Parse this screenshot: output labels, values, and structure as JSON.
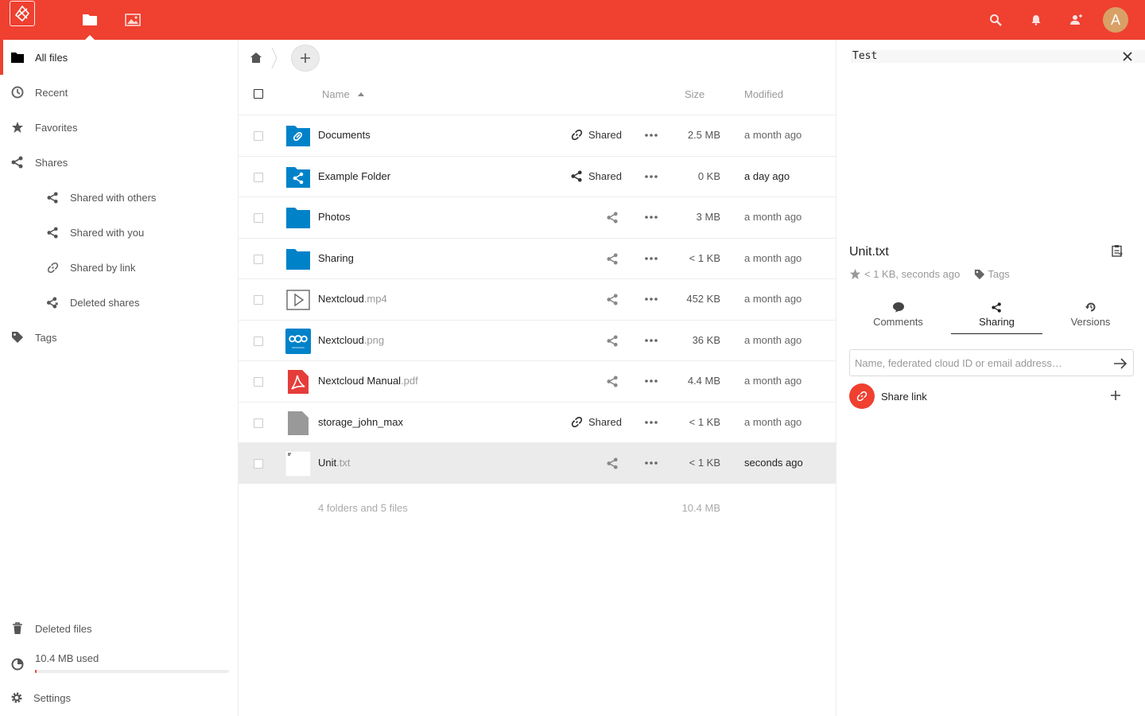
{
  "header": {
    "logo": "nextcloud-logo-icon",
    "apps": [
      {
        "name": "files-icon",
        "active": true
      },
      {
        "name": "gallery-icon",
        "active": false
      }
    ],
    "right_icons": [
      "search-icon",
      "bell-icon",
      "contacts-icon"
    ],
    "avatar_letter": "A",
    "colors": {
      "brand": "#ef4030",
      "avatar": "#d9a066"
    }
  },
  "sidebar": {
    "items": [
      {
        "label": "All files",
        "icon": "folder-icon"
      },
      {
        "label": "Recent",
        "icon": "clock-icon"
      },
      {
        "label": "Favorites",
        "icon": "star-icon"
      },
      {
        "label": "Shares",
        "icon": "share-icon"
      },
      {
        "label": "Shared with others",
        "icon": "share-icon"
      },
      {
        "label": "Shared with you",
        "icon": "share-icon"
      },
      {
        "label": "Shared by link",
        "icon": "link-icon"
      },
      {
        "label": "Deleted shares",
        "icon": "deleted-share-icon"
      },
      {
        "label": "Tags",
        "icon": "tag-icon"
      }
    ],
    "deleted_files": "Deleted files",
    "quota": "10.4 MB used",
    "settings": "Settings"
  },
  "files": {
    "columns": {
      "name": "Name",
      "size": "Size",
      "modified": "Modified"
    },
    "rows": [
      {
        "name": "Documents",
        "ext": "",
        "type": "folder-link",
        "share": "Shared",
        "share_icon": "link",
        "size": "2.5 MB",
        "modified": "a month ago"
      },
      {
        "name": "Example Folder",
        "ext": "",
        "type": "folder-shared",
        "share": "Shared",
        "share_icon": "share",
        "size": "0 KB",
        "modified": "a day ago"
      },
      {
        "name": "Photos",
        "ext": "",
        "type": "folder",
        "share": "",
        "share_icon": "",
        "size": "3 MB",
        "modified": "a month ago"
      },
      {
        "name": "Sharing",
        "ext": "",
        "type": "folder",
        "share": "",
        "share_icon": "",
        "size": "< 1 KB",
        "modified": "a month ago"
      },
      {
        "name": "Nextcloud",
        "ext": ".mp4",
        "type": "video",
        "share": "",
        "share_icon": "",
        "size": "452 KB",
        "modified": "a month ago"
      },
      {
        "name": "Nextcloud",
        "ext": ".png",
        "type": "image",
        "share": "",
        "share_icon": "",
        "size": "36 KB",
        "modified": "a month ago"
      },
      {
        "name": "Nextcloud Manual",
        "ext": ".pdf",
        "type": "pdf",
        "share": "",
        "share_icon": "",
        "size": "4.4 MB",
        "modified": "a month ago"
      },
      {
        "name": "storage_john_max",
        "ext": "",
        "type": "file",
        "share": "Shared",
        "share_icon": "link",
        "size": "< 1 KB",
        "modified": "a month ago"
      },
      {
        "name": "Unit",
        "ext": ".txt",
        "type": "text",
        "share": "",
        "share_icon": "",
        "size": "< 1 KB",
        "modified": "seconds ago"
      }
    ],
    "summary_count": "4 folders and 5 files",
    "summary_size": "10.4 MB"
  },
  "details": {
    "preview_text": "Test",
    "filename": "Unit.txt",
    "meta": "< 1 KB, seconds ago",
    "tags_label": "Tags",
    "tabs": [
      {
        "label": "Comments",
        "icon": "comment-icon"
      },
      {
        "label": "Sharing",
        "icon": "share-icon"
      },
      {
        "label": "Versions",
        "icon": "history-icon"
      }
    ],
    "share_placeholder": "Name, federated cloud ID or email address…",
    "share_link_label": "Share link"
  }
}
